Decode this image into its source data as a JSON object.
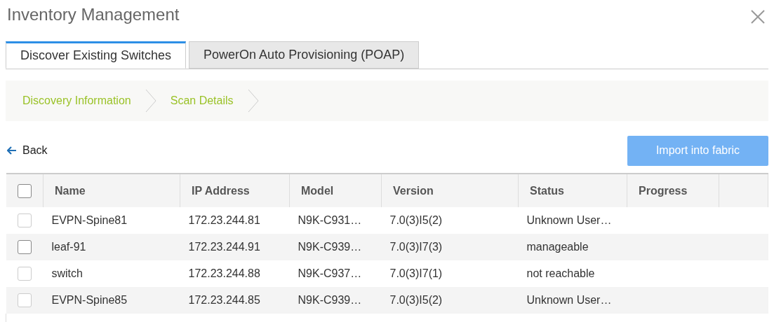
{
  "window": {
    "title": "Inventory Management"
  },
  "tabs": [
    {
      "label": "Discover Existing Switches",
      "selected": true
    },
    {
      "label": "PowerOn Auto Provisioning (POAP)",
      "selected": false
    }
  ],
  "steps": [
    "Discovery Information",
    "Scan Details"
  ],
  "back": {
    "label": "Back"
  },
  "import_button": {
    "label": "Import into fabric",
    "disabled": true
  },
  "table": {
    "select_all": {
      "checked": false
    },
    "columns": [
      "Name",
      "IP Address",
      "Model",
      "Version",
      "Status",
      "Progress"
    ],
    "rows": [
      {
        "checked": false,
        "disabled": true,
        "cells": [
          "EVPN-Spine81",
          "172.23.244.81",
          "N9K-C931…",
          "7.0(3)I5(2)",
          "Unknown User…"
        ]
      },
      {
        "checked": false,
        "disabled": false,
        "cells": [
          "leaf-91",
          "172.23.244.91",
          "N9K-C939…",
          "7.0(3)I7(3)",
          "manageable"
        ]
      },
      {
        "checked": false,
        "disabled": true,
        "cells": [
          "switch",
          "172.23.244.88",
          "N9K-C937…",
          "7.0(3)I7(1)",
          "not reachable"
        ]
      },
      {
        "checked": false,
        "disabled": true,
        "cells": [
          "EVPN-Spine85",
          "172.23.244.85",
          "N9K-C939…",
          "7.0(3)I5(2)",
          "Unknown User…"
        ]
      }
    ]
  }
}
